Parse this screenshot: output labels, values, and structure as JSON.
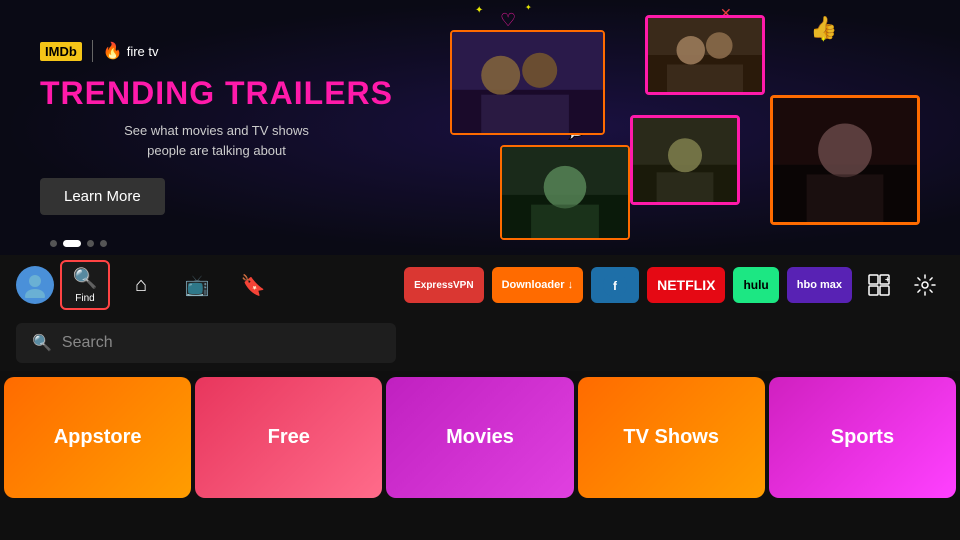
{
  "hero": {
    "imdb_label": "IMDb",
    "firetv_label": "fire tv",
    "title": "TRENDING TRAILERS",
    "subtitle_line1": "See what movies and TV shows",
    "subtitle_line2": "people are talking about",
    "learn_more": "Learn More"
  },
  "pagination": {
    "dots": [
      false,
      true,
      false,
      false
    ]
  },
  "nav": {
    "find_label": "Find",
    "home_label": "Home",
    "live_label": "Live",
    "watchlist_label": "Watchlist",
    "search_placeholder": "Search"
  },
  "apps": [
    {
      "id": "expressvpn",
      "label": "ExpressVPN",
      "class": "expressvpn"
    },
    {
      "id": "downloader",
      "label": "Downloader ↓",
      "class": "downloader"
    },
    {
      "id": "blue",
      "label": "🔵",
      "class": "blue-app"
    },
    {
      "id": "netflix",
      "label": "NETFLIX",
      "class": "netflix"
    },
    {
      "id": "hulu",
      "label": "hulu",
      "class": "hulu"
    },
    {
      "id": "hbomax",
      "label": "hbo max",
      "class": "hbomax"
    }
  ],
  "categories": [
    {
      "id": "appstore",
      "label": "Appstore",
      "class": "appstore"
    },
    {
      "id": "free",
      "label": "Free",
      "class": "free"
    },
    {
      "id": "movies",
      "label": "Movies",
      "class": "movies"
    },
    {
      "id": "tvshows",
      "label": "TV Shows",
      "class": "tvshows"
    },
    {
      "id": "sports",
      "label": "Sports",
      "class": "sports"
    }
  ],
  "colors": {
    "accent_pink": "#ff1aaa",
    "accent_orange": "#ff6b00",
    "bg_dark": "#0f0f0f"
  }
}
